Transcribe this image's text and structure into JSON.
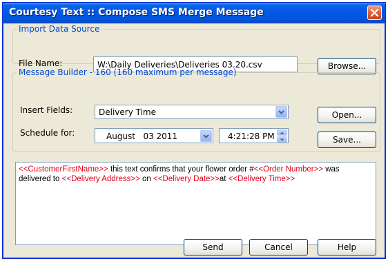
{
  "window": {
    "title": "Courtesy Text :: Compose SMS Merge Message"
  },
  "import_group": {
    "legend": "Import Data Source",
    "file_label": "File Name:",
    "file_value": "W:\\Daily Deliveries\\Deliveries 03.20.csv",
    "browse_label": "Browse..."
  },
  "builder_group": {
    "legend": "Message Builder - 160 (160 maximum per message)",
    "insert_label": "Insert Fields:",
    "insert_value": "Delivery Time",
    "schedule_label": "Schedule for:",
    "date_value": "August   03 2011",
    "time_value": "4:21:28 PM",
    "open_label": "Open...",
    "save_label": "Save..."
  },
  "message": {
    "segments": [
      {
        "text": "<<CustomerFirstName>>",
        "field": true
      },
      {
        "text": " this text confirms that your flower order #",
        "field": false
      },
      {
        "text": "<<Order Number>>",
        "field": true
      },
      {
        "text": " was delivered to ",
        "field": false
      },
      {
        "text": "<<Delivery Address>>",
        "field": true
      },
      {
        "text": " on ",
        "field": false
      },
      {
        "text": "<<Delivery Date>>",
        "field": true
      },
      {
        "text": "at ",
        "field": false
      },
      {
        "text": "<<Delivery Time>>",
        "field": true
      }
    ]
  },
  "footer": {
    "send_label": "Send",
    "cancel_label": "Cancel",
    "help_label": "Help"
  },
  "colors": {
    "titlebar": "#0058e6",
    "legend": "#0046d5",
    "merge_field": "#e2001a",
    "dialog_bg": "#ece9d8"
  },
  "icons": {
    "close": "close-icon",
    "dropdown": "chevron-down-icon",
    "spin_up": "spin-up-icon",
    "spin_down": "spin-down-icon"
  }
}
